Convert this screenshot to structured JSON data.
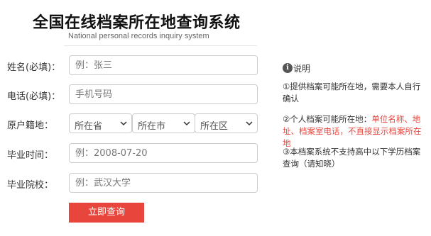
{
  "header": {
    "title": "全国在线档案所在地查询系统",
    "subtitle": "National personal records inquiry system"
  },
  "form": {
    "name": {
      "label": "姓名(必填)：",
      "placeholder": "例：张三"
    },
    "phone": {
      "label": "电话(必填)：",
      "placeholder": "手机号码"
    },
    "origin": {
      "label": "原户籍地：",
      "province": "所在省",
      "city": "所在市",
      "district": "所在区"
    },
    "graduation_time": {
      "label": "毕业时间：",
      "placeholder": "例：2008-07-20"
    },
    "school": {
      "label": "毕业院校：",
      "placeholder": "例：武汉大学"
    },
    "submit_label": "立即查询"
  },
  "info": {
    "icon": "info-icon",
    "icon_glyph": "i",
    "heading": "说明",
    "note1": "①提供档案可能所在地，需要本人自行确认",
    "note2_prefix": "②个人档案可能所在地：",
    "note2_highlight": "单位名称、地址、档案室电话，不直接显示档案所在地",
    "note3": "③本档案系统不支持高中以下学历档案查询（请知晓）"
  },
  "colors": {
    "accent": "#e8453c",
    "border": "#cccccc",
    "text": "#333333"
  }
}
